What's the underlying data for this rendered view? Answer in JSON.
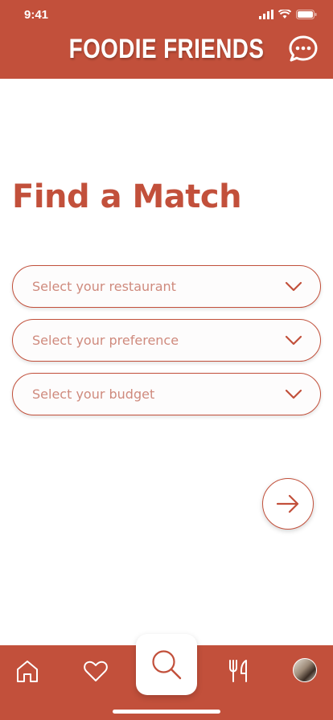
{
  "status_bar": {
    "time": "9:41"
  },
  "header": {
    "title": "FOODIE FRIENDS",
    "chat_icon": "chat-bubble-icon"
  },
  "main": {
    "title": "Find a Match",
    "selects": [
      {
        "placeholder": "Select your restaurant"
      },
      {
        "placeholder": "Select your preference"
      },
      {
        "placeholder": "Select your budget"
      }
    ],
    "next_icon": "arrow-right-icon"
  },
  "tabbar": {
    "items": [
      "home-icon",
      "heart-icon",
      "search-icon",
      "fork-knife-icon",
      "avatar"
    ],
    "active": "search-icon"
  },
  "colors": {
    "brand": "#c2503b",
    "placeholder": "#cf8a7d",
    "background": "#ffffff"
  }
}
